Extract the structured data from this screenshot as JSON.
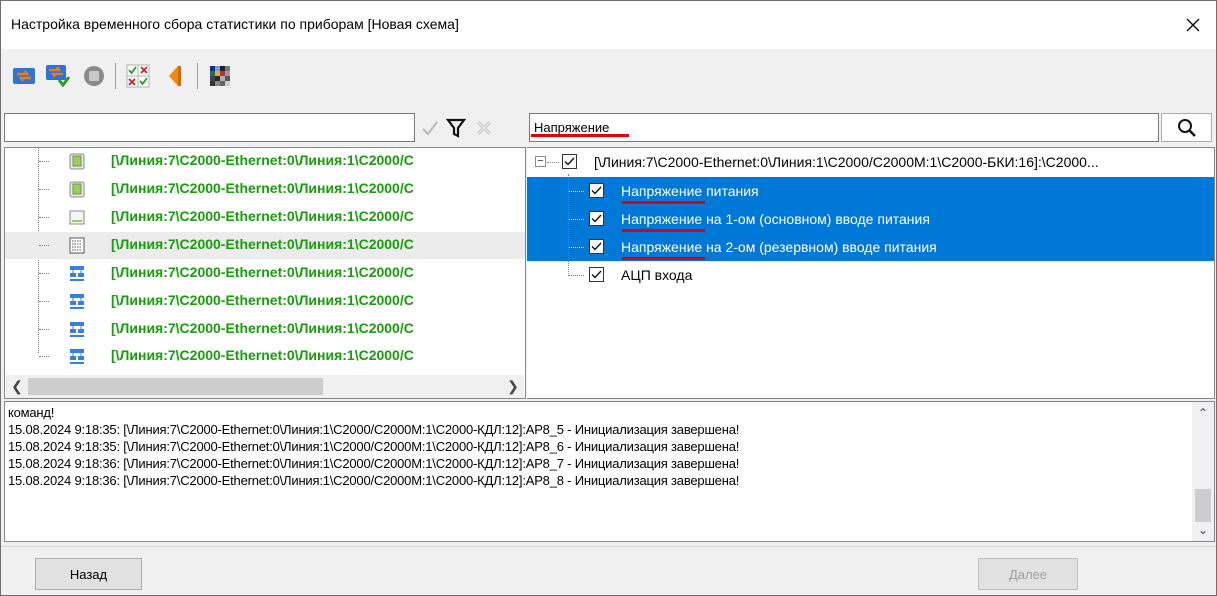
{
  "window": {
    "title": "Настройка временного сбора статистики по приборам [Новая схема]",
    "close_icon": "close-icon"
  },
  "toolbar": {
    "icons": [
      "refresh-icon",
      "refresh-settings-icon",
      "stop-icon",
      "check-grid-icon",
      "back-arrow-icon",
      "color-palette-icon"
    ]
  },
  "filter": {
    "value": "",
    "icons": [
      "apply-check-icon",
      "filter-icon",
      "clear-filter-icon"
    ]
  },
  "search": {
    "value": "Напряжение",
    "button_icon": "search-icon"
  },
  "left_tree": {
    "items": [
      {
        "label": "[\\Линия:7\\C2000-Ethernet:0\\Линия:1\\C2000/С",
        "icon": "device-icon"
      },
      {
        "label": "[\\Линия:7\\C2000-Ethernet:0\\Линия:1\\C2000/С",
        "icon": "device-icon"
      },
      {
        "label": "[\\Линия:7\\C2000-Ethernet:0\\Линия:1\\C2000/С",
        "icon": "panel-icon"
      },
      {
        "label": "[\\Линия:7\\C2000-Ethernet:0\\Линия:1\\C2000/С",
        "icon": "keypad-icon"
      },
      {
        "label": "[\\Линия:7\\C2000-Ethernet:0\\Линия:1\\C2000/С",
        "icon": "network-icon"
      },
      {
        "label": "[\\Линия:7\\C2000-Ethernet:0\\Линия:1\\C2000/С",
        "icon": "network-icon"
      },
      {
        "label": "[\\Линия:7\\C2000-Ethernet:0\\Линия:1\\C2000/С",
        "icon": "network-icon"
      },
      {
        "label": "[\\Линия:7\\C2000-Ethernet:0\\Линия:1\\C2000/С",
        "icon": "network-icon"
      }
    ]
  },
  "right_tree": {
    "root": "[\\Линия:7\\C2000-Ethernet:0\\Линия:1\\C2000/C2000M:1\\C2000-БКИ:16]:\\C2000...",
    "children": [
      {
        "label": "Напряжение питания",
        "selected": true,
        "checked": true
      },
      {
        "label": "Напряжение на 1-ом (основном) вводе питания",
        "selected": true,
        "checked": true
      },
      {
        "label": "Напряжение на 2-ом (резервном) вводе питания",
        "selected": true,
        "checked": true
      },
      {
        "label": "АЦП входа",
        "selected": false,
        "checked": true
      }
    ]
  },
  "log": {
    "lines": [
      "команд!",
      "15.08.2024 9:18:35: [\\Линия:7\\C2000-Ethernet:0\\Линия:1\\C2000/C2000M:1\\C2000-КДЛ:12]:AP8_5 - Инициализация завершена!",
      "15.08.2024 9:18:35: [\\Линия:7\\C2000-Ethernet:0\\Линия:1\\C2000/C2000M:1\\C2000-КДЛ:12]:AP8_6 - Инициализация завершена!",
      "15.08.2024 9:18:36: [\\Линия:7\\C2000-Ethernet:0\\Линия:1\\C2000/C2000M:1\\C2000-КДЛ:12]:AP8_7 - Инициализация завершена!",
      "15.08.2024 9:18:36: [\\Линия:7\\C2000-Ethernet:0\\Линия:1\\C2000/C2000M:1\\C2000-КДЛ:12]:AP8_8 - Инициализация завершена!"
    ]
  },
  "buttons": {
    "back": "Назад",
    "next": "Далее"
  },
  "colors": {
    "selection": "#0078d7",
    "tree_text_green": "#179e0b",
    "highlight_underline": "#e00000"
  }
}
